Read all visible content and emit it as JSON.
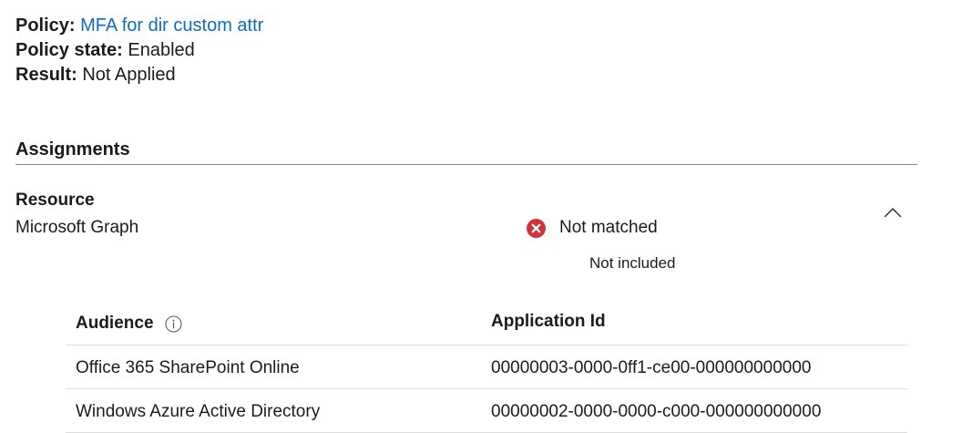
{
  "policy": {
    "name_label": "Policy:",
    "name_value": "MFA for dir custom attr",
    "state_label": "Policy state:",
    "state_value": "Enabled",
    "result_label": "Result:",
    "result_value": "Not Applied"
  },
  "assignments": {
    "title": "Assignments",
    "resource": {
      "title": "Resource",
      "value": "Microsoft Graph",
      "status": "Not matched",
      "status_detail": "Not included",
      "status_icon": "error-circle-icon",
      "status_color": "#d13438",
      "toggle_icon": "chevron-up-icon"
    },
    "table": {
      "headers": {
        "audience": "Audience",
        "audience_info_icon": "info-icon",
        "application_id": "Application Id"
      },
      "rows": [
        {
          "audience": "Office 365 SharePoint Online",
          "application_id": "00000003-0000-0ff1-ce00-000000000000"
        },
        {
          "audience": "Windows Azure Active Directory",
          "application_id": "00000002-0000-0000-c000-000000000000"
        }
      ]
    }
  },
  "colors": {
    "link": "#0f6cbd",
    "text": "#1b1b1b",
    "error": "#d13438",
    "divider": "#8a8886",
    "row_border": "#e1dfdd"
  }
}
